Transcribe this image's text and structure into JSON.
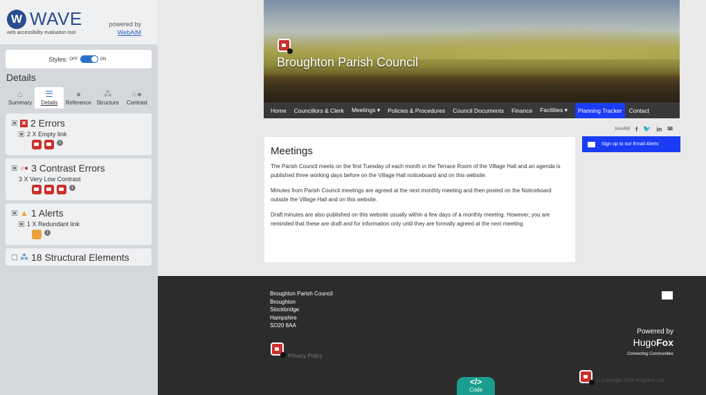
{
  "wave": {
    "logo_mark": "W",
    "logo_text": "WAVE",
    "tagline": "web accessibility evaluation tool",
    "powered_by": "powered by",
    "powered_link": "WebAIM",
    "styles_label": "Styles:",
    "styles_off": "OFF",
    "styles_on": "ON",
    "details_title": "Details",
    "tabs": [
      {
        "label": "Summary",
        "icon": "home-icon"
      },
      {
        "label": "Details",
        "icon": "list-icon"
      },
      {
        "label": "Reference",
        "icon": "info-icon"
      },
      {
        "label": "Structure",
        "icon": "structure-icon"
      },
      {
        "label": "Contrast",
        "icon": "contrast-icon"
      }
    ],
    "errors": {
      "title": "2 Errors",
      "item": "2 X Empty link"
    },
    "contrast": {
      "title": "3 Contrast Errors",
      "item": "3 X Very Low Contrast"
    },
    "alerts": {
      "title": "1 Alerts",
      "item": "1 X Redundant link"
    },
    "structure": {
      "title": "18 Structural Elements"
    }
  },
  "site": {
    "title": "Broughton Parish Council",
    "nav": [
      "Home",
      "Councillors & Clerk",
      "Meetings ▾",
      "Policies & Procedures",
      "Council Documents",
      "Finance",
      "Facilities ▾",
      "Planning Tracker",
      "Contact"
    ],
    "share_label": "SHARE",
    "share_icons": {
      "facebook": "f",
      "twitter": "🐦",
      "linkedin": "in",
      "email": "✉"
    },
    "signup": "Sign up to our Email Alerts",
    "heading": "Meetings",
    "paragraphs": [
      "The Parish Council meets on the first Tuesday of each month in the Terrace Room of the Village Hall and an agenda is published three working days before on the Village Hall noticeboard and on this website.",
      "Minutes from Parish Council meetings are agreed at the next monthly meeting and then posted on the Noticeboard outside the Village Hall and on this website.",
      "Draft minutes are also published on this website usually within a few days of a monthly meeting. However, you are reminded that these are draft and for information only until they are formally agreed at the next meeting."
    ],
    "footer": {
      "address": [
        "Broughton Parish Council",
        "Broughton",
        "Stockbridge",
        "Hampshire",
        "SO20 8AA"
      ],
      "privacy": "Privacy Policy",
      "powered_by": "Powered by",
      "brand_a": "Hugo",
      "brand_b": "Fox",
      "brand_tag": "Connecting Communities",
      "copyright": "© Copyright 2020 HugoFox Ltd."
    },
    "code_button": {
      "icon": "</>",
      "label": "Code"
    }
  },
  "colors": {
    "accent": "#1a3cf5",
    "nav": "#38393b",
    "footer": "#2c2c2c",
    "error": "#c9302c",
    "code": "#1b9e8f"
  }
}
